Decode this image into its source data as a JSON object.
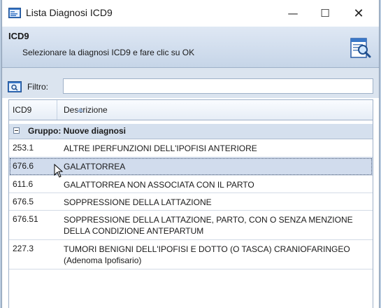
{
  "window": {
    "title": "Lista Diagnosi ICD9",
    "minimize_glyph": "—",
    "maximize_glyph": "☐",
    "close_glyph": "✕"
  },
  "header": {
    "title": "ICD9",
    "subtitle": "Selezionare la diagnosi ICD9 e fare clic su OK",
    "icon": "document-search-icon"
  },
  "filter": {
    "label": "Filtro:",
    "value": "",
    "placeholder": ""
  },
  "grid": {
    "columns": [
      "ICD9",
      "Descrizione"
    ],
    "sort_column": "Descrizione",
    "sort_direction": "ascending",
    "group": {
      "label": "Gruppo: Nuove diagnosi",
      "expanded": true
    },
    "rows": [
      {
        "code": "253.1",
        "description": "ALTRE IPERFUNZIONI DELL'IPOFISI ANTERIORE",
        "selected": false
      },
      {
        "code": "676.6",
        "description": "GALATTORREA",
        "selected": true
      },
      {
        "code": "611.6",
        "description": "GALATTORREA NON ASSOCIATA CON IL PARTO",
        "selected": false
      },
      {
        "code": "676.5",
        "description": "SOPPRESSIONE DELLA LATTAZIONE",
        "selected": false
      },
      {
        "code": "676.51",
        "description": "SOPPRESSIONE DELLA LATTAZIONE, PARTO, CON O SENZA MENZIONE DELLA CONDIZIONE ANTEPARTUM",
        "selected": false
      },
      {
        "code": "227.3",
        "description": "TUMORI BENIGNI DELL'IPOFISI E DOTTO (O TASCA) CRANIOFARINGEO (Adenoma Ipofisario)",
        "selected": false
      }
    ]
  },
  "colors": {
    "header_bg": "#c6d5e8",
    "selected_row": "#d1dced",
    "group_bg": "#d5e0ee",
    "border": "#9fb1c8"
  }
}
